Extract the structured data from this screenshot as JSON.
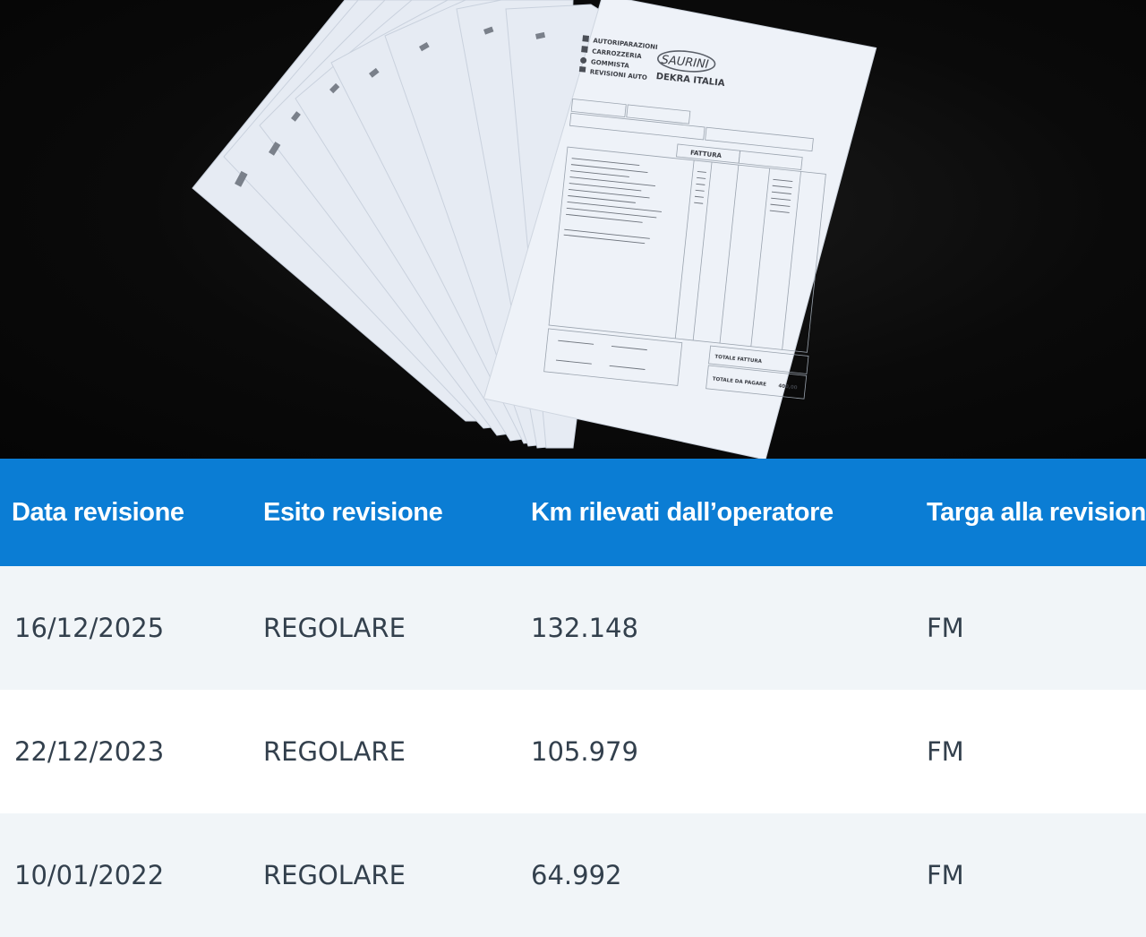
{
  "photo": {
    "invoice": {
      "logo_text": "SAURINI",
      "brand_text": "DEKRA ITALIA",
      "services": [
        "AUTORIPARAZIONI",
        "CARROZZERIA",
        "GOMMISTA",
        "REVISIONI AUTO"
      ],
      "doc_type": "FATTURA",
      "total_invoice_label": "TOTALE FATTURA",
      "total_due_label": "TOTALE DA PAGARE",
      "total_value": "400,00"
    }
  },
  "table": {
    "headers": [
      "Data revisione",
      "Esito revisione",
      "Km rilevati dall’operatore",
      "Targa alla revisione"
    ],
    "rows": [
      {
        "date": "16/12/2025",
        "result": "REGOLARE",
        "km": "132.148",
        "plate": "FM"
      },
      {
        "date": "22/12/2023",
        "result": "REGOLARE",
        "km": "105.979",
        "plate": "FM"
      },
      {
        "date": "10/01/2022",
        "result": "REGOLARE",
        "km": "64.992",
        "plate": "FM"
      }
    ]
  },
  "colors": {
    "header_bg": "#0b7dd4",
    "header_text": "#ffffff",
    "row_alt_bg": "#f1f5f8",
    "cell_text": "#33404d",
    "photo_bg": "#0a0a0a"
  }
}
